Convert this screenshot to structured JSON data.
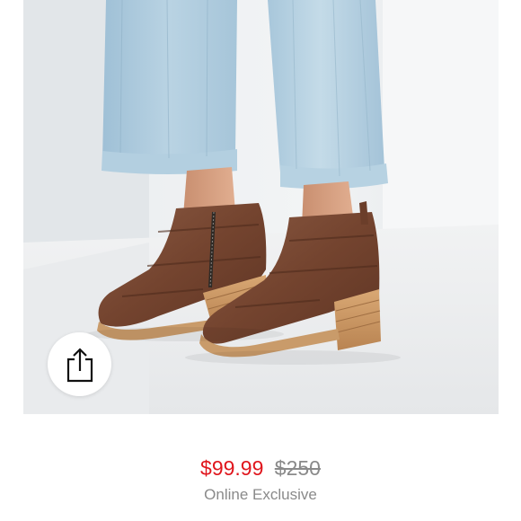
{
  "product": {
    "image_alt": "Brown leather ankle boots with stacked wooden heels worn with light-wash cropped jeans",
    "sale_price": "$99.99",
    "original_price": "$250",
    "badge": "Online Exclusive"
  },
  "actions": {
    "share_icon": "share-icon"
  },
  "colors": {
    "sale_price": "#e0161d",
    "muted_text": "#8a8a8a",
    "background": "#ffffff"
  }
}
